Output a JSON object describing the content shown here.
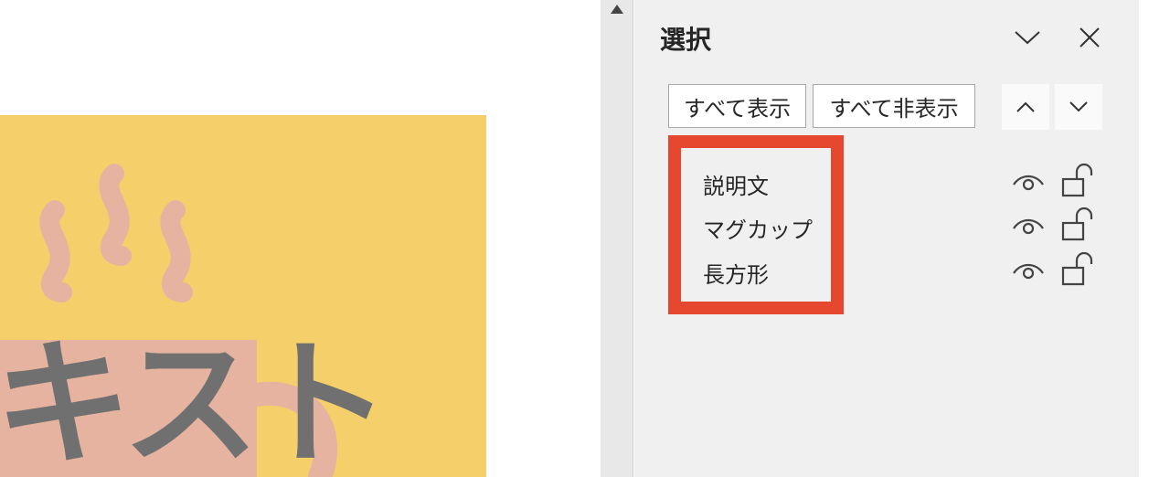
{
  "slide": {
    "text": "キスト"
  },
  "selection_pane": {
    "title": "選択",
    "show_all_label": "すべて表示",
    "hide_all_label": "すべて非表示",
    "objects": [
      {
        "label": "説明文",
        "visible": true,
        "locked": false
      },
      {
        "label": "マグカップ",
        "visible": true,
        "locked": false
      },
      {
        "label": "長方形",
        "visible": true,
        "locked": false
      }
    ]
  },
  "colors": {
    "slide_background": "#f5d06a",
    "mug": "#e6b3a0",
    "text_gray": "#707070",
    "highlight": "#e5472f",
    "pane_background": "#f0f0f0"
  },
  "icons": {
    "collapse": "chevron-down-icon",
    "close": "close-icon",
    "move_up": "chevron-up-icon",
    "move_down": "chevron-down-icon",
    "visibility": "eye-icon",
    "lock": "unlock-icon",
    "scroll": "triangle-up-icon"
  }
}
